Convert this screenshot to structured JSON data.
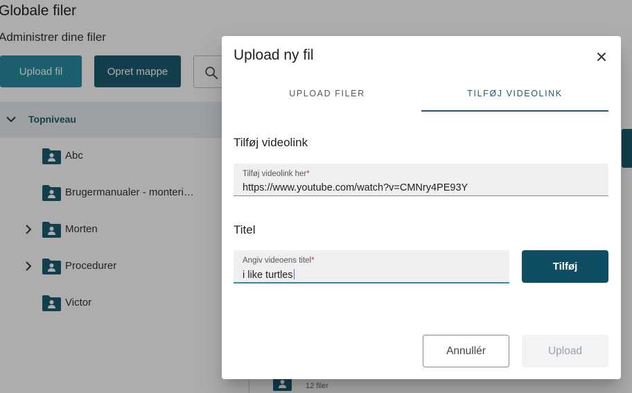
{
  "background": {
    "title": "Globale filer",
    "subtitle": "Administrer dine filer",
    "upload_button": "Upload fil",
    "new_folder_button": "Opret mappe",
    "tree_root": "Topniveau",
    "folders": [
      {
        "label": "Abc",
        "expandable": false
      },
      {
        "label": "Brugermanualer - monteri…",
        "expandable": false
      },
      {
        "label": "Morten",
        "expandable": true
      },
      {
        "label": "Procedurer",
        "expandable": true
      },
      {
        "label": "Victor",
        "expandable": false
      }
    ],
    "files_count": "12 filer"
  },
  "dialog": {
    "title": "Upload ny fil",
    "close_icon": "close-icon",
    "tabs": [
      {
        "label": "UPLOAD FILER",
        "active": false
      },
      {
        "label": "TILFØJ VIDEOLINK",
        "active": true
      }
    ],
    "video_section_title": "Tilføj videolink",
    "video_field": {
      "label": "Tilføj videolink her",
      "required_mark": "*",
      "value": "https://www.youtube.com/watch?v=CMNry4PE93Y"
    },
    "title_section_title": "Titel",
    "title_field": {
      "label": "Angiv videoens titel",
      "required_mark": "*",
      "value": "i like turtles"
    },
    "add_button": "Tilføj",
    "cancel_button": "Annullér",
    "upload_button": "Upload"
  },
  "colors": {
    "accent_dark": "#1d5c70",
    "accent_light": "#2a8ea6",
    "required": "#d32f2f"
  }
}
